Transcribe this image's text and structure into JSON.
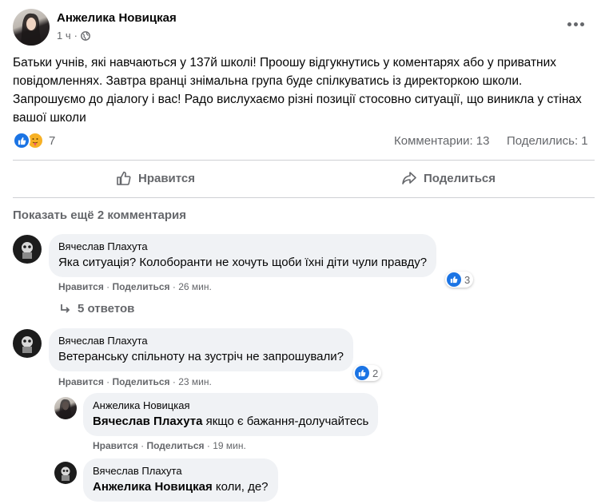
{
  "post": {
    "author": "Анжелика Новицкая",
    "time": "1 ч",
    "privacy_icon": "globe-icon",
    "text": "Батьки учнів, які навчаються у 137й школі! Проошу відгукнутись у коментарях або у приватних повідомленнях. Завтра вранці знімальна група буде спілкуватись із директоркою школи. Запрошуємо до діалогу і вас! Радо вислухаємо різні позиції стосовно ситуації, що виникла у стінах вашої школи",
    "reactions_count": "7",
    "comments_count": "Комментарии: 13",
    "shares_count": "Поделились: 1"
  },
  "actions": {
    "like": "Нравится",
    "share": "Поделиться"
  },
  "show_more": "Показать ещё 2 комментария",
  "comments": [
    {
      "author": "Вячеслав Плахута",
      "text": "Яка ситуація? Колоборанти не хочуть щоби їхні діти чули правду?",
      "like": "Нравится",
      "reply": "Поделиться",
      "time": "26 мин.",
      "reactions": "3",
      "replies_label": "5 ответов"
    },
    {
      "author": "Вячеслав Плахута",
      "text": "Ветеранську спільноту на зустріч не запрошували?",
      "like": "Нравится",
      "reply": "Поделиться",
      "time": "23 мин.",
      "reactions": "2"
    }
  ],
  "replies": [
    {
      "author": "Анжелика Новицкая",
      "mention": "Вячеслав Плахута",
      "text": " якщо є бажання-долучайтесь",
      "like": "Нравится",
      "reply": "Поделиться",
      "time": "19 мин."
    },
    {
      "author": "Вячеслав Плахута",
      "mention": "Анжелика Новицкая",
      "text": " коли, де?"
    }
  ],
  "colors": {
    "like_blue": "#1b74e4",
    "muted": "#65676b",
    "bubble": "#f0f2f5"
  }
}
